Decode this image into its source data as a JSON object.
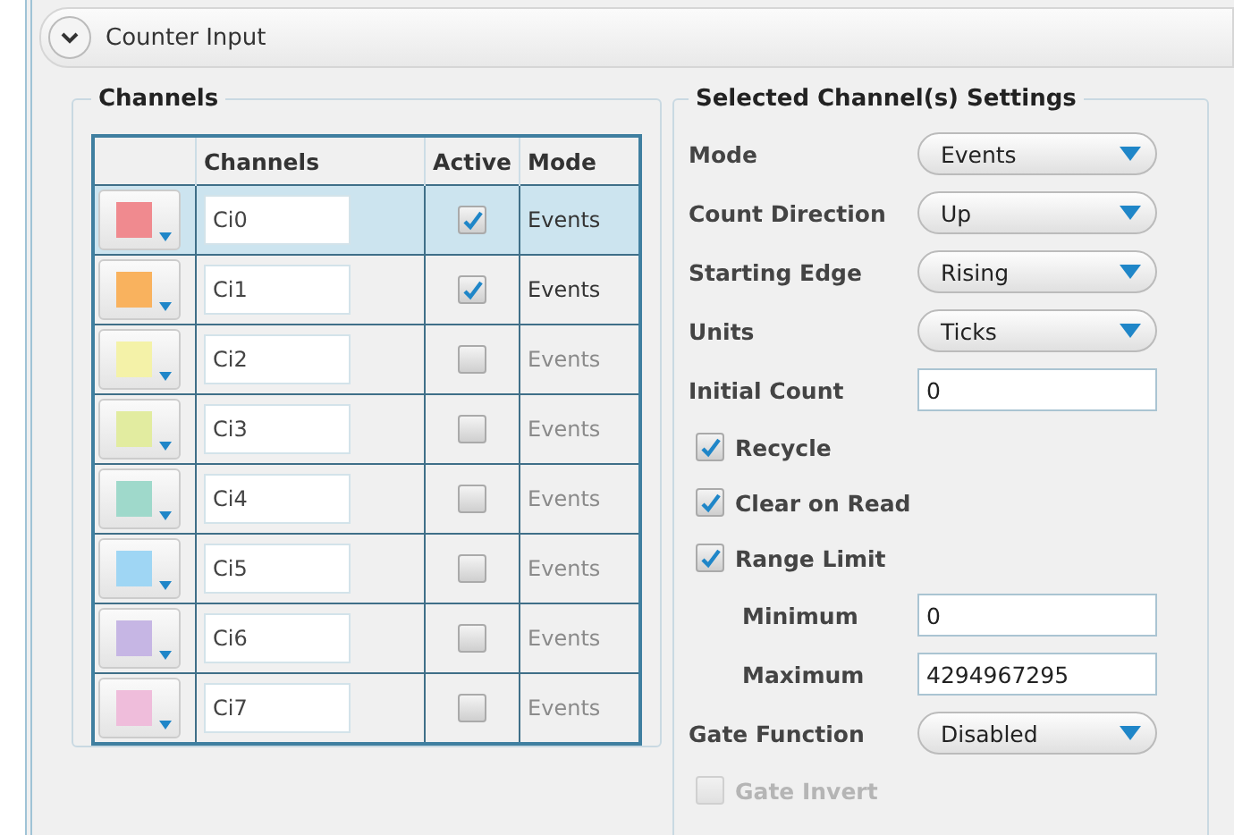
{
  "panel": {
    "title": "Counter Input",
    "expanded": true
  },
  "channels_group": {
    "title": "Channels",
    "columns": [
      "Channels",
      "Active",
      "Mode"
    ],
    "rows": [
      {
        "color": "#f08a8f",
        "name": "Ci0",
        "active": true,
        "mode": "Events",
        "selected": true
      },
      {
        "color": "#f9b25e",
        "name": "Ci1",
        "active": true,
        "mode": "Events",
        "selected": false
      },
      {
        "color": "#f4f2a8",
        "name": "Ci2",
        "active": false,
        "mode": "Events",
        "selected": false
      },
      {
        "color": "#e2eca0",
        "name": "Ci3",
        "active": false,
        "mode": "Events",
        "selected": false
      },
      {
        "color": "#9fd9cb",
        "name": "Ci4",
        "active": false,
        "mode": "Events",
        "selected": false
      },
      {
        "color": "#9fd6f4",
        "name": "Ci5",
        "active": false,
        "mode": "Events",
        "selected": false
      },
      {
        "color": "#c6b6e4",
        "name": "Ci6",
        "active": false,
        "mode": "Events",
        "selected": false
      },
      {
        "color": "#efbddb",
        "name": "Ci7",
        "active": false,
        "mode": "Events",
        "selected": false
      }
    ]
  },
  "settings_group": {
    "title": "Selected Channel(s) Settings",
    "items": [
      {
        "kind": "dropdown",
        "label": "Mode",
        "value": "Events"
      },
      {
        "kind": "dropdown",
        "label": "Count Direction",
        "value": "Up"
      },
      {
        "kind": "dropdown",
        "label": "Starting Edge",
        "value": "Rising"
      },
      {
        "kind": "dropdown",
        "label": "Units",
        "value": "Ticks"
      },
      {
        "kind": "field",
        "label": "Initial Count",
        "value": "0"
      },
      {
        "kind": "checkbox",
        "label": "Recycle",
        "checked": true,
        "disabled": false
      },
      {
        "kind": "checkbox",
        "label": "Clear on Read",
        "checked": true,
        "disabled": false
      },
      {
        "kind": "checkbox",
        "label": "Range Limit",
        "checked": true,
        "disabled": false,
        "children": [
          {
            "kind": "field",
            "label": "Minimum",
            "value": "0"
          },
          {
            "kind": "field",
            "label": "Maximum",
            "value": "4294967295"
          }
        ]
      },
      {
        "kind": "dropdown",
        "label": "Gate Function",
        "value": "Disabled"
      },
      {
        "kind": "checkbox",
        "label": "Gate Invert",
        "checked": false,
        "disabled": true
      }
    ]
  }
}
